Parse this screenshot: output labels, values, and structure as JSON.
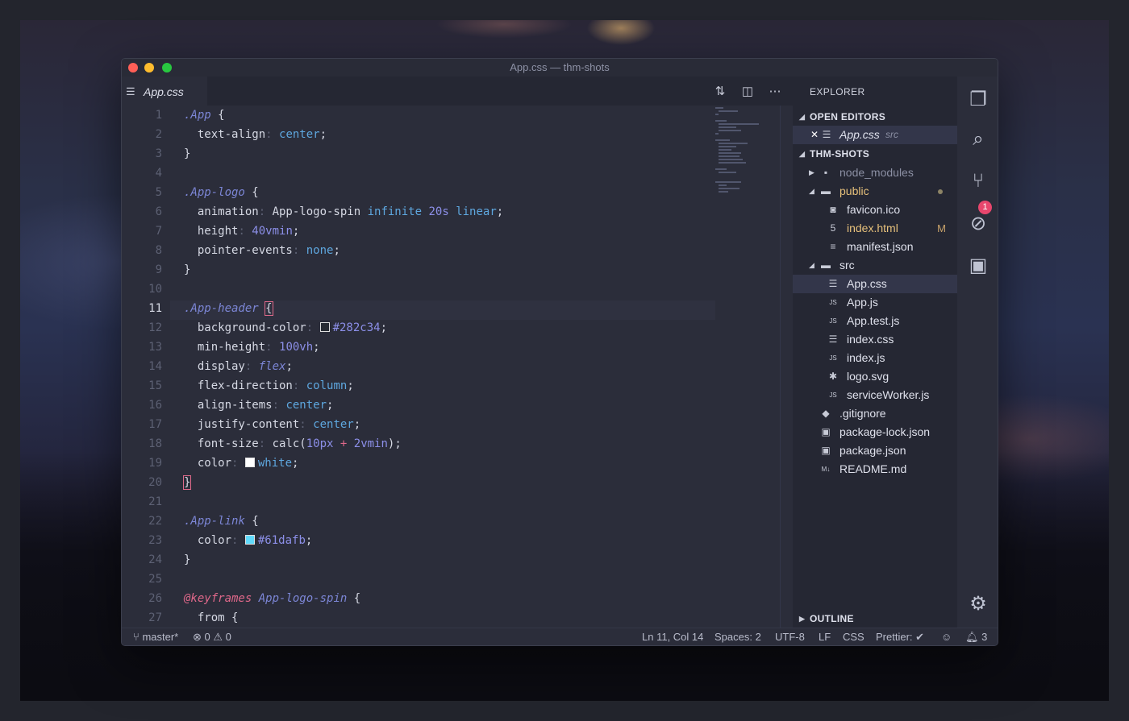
{
  "window": {
    "title": "App.css — thm-shots"
  },
  "tab": {
    "label": "App.css",
    "icon": "css-file-icon"
  },
  "tab_actions": [
    "open-changes-icon",
    "split-editor-icon",
    "more-actions-icon"
  ],
  "editor": {
    "current_line": 11,
    "line_numbers": [
      "1",
      "2",
      "3",
      "4",
      "5",
      "6",
      "7",
      "8",
      "9",
      "10",
      "11",
      "12",
      "13",
      "14",
      "15",
      "16",
      "17",
      "18",
      "19",
      "20",
      "21",
      "22",
      "23",
      "24",
      "25",
      "26",
      "27"
    ]
  },
  "code": {
    "l1_sel": ".App",
    "l1_brace": " {",
    "l2_prop": "text-align",
    "l2_val": "center",
    "l3": "}",
    "l5_sel": ".App-logo",
    "l5_brace": " {",
    "l6_prop": "animation",
    "l6_name": "App-logo-spin",
    "l6_inf": "infinite",
    "l6_time": "20s",
    "l6_lin": "linear",
    "l7_prop": "height",
    "l7_val": "40vmin",
    "l8_prop": "pointer-events",
    "l8_val": "none",
    "l9": "}",
    "l11_sel": ".App-header",
    "l11_brace": "{",
    "l12_prop": "background-color",
    "l12_val": "#282c34",
    "l13_prop": "min-height",
    "l13_val": "100vh",
    "l14_prop": "display",
    "l14_val": "flex",
    "l15_prop": "flex-direction",
    "l15_val": "column",
    "l16_prop": "align-items",
    "l16_val": "center",
    "l17_prop": "justify-content",
    "l17_val": "center",
    "l18_prop": "font-size",
    "l18_fn": "calc(",
    "l18_a": "10px",
    "l18_op": "+",
    "l18_b": "2vmin",
    "l18_end": ");",
    "l19_prop": "color",
    "l19_val": "white",
    "l20": "}",
    "l22_sel": ".App-link",
    "l22_brace": " {",
    "l23_prop": "color",
    "l23_val": "#61dafb",
    "l24": "}",
    "l26_at": "@keyframes",
    "l26_name": "App-logo-spin",
    "l26_brace": " {",
    "l27": "from {"
  },
  "swatch_colors": {
    "l12": "#282c34",
    "l19": "#ffffff",
    "l23": "#61dafb"
  },
  "sidebar": {
    "header": "EXPLORER",
    "open_editors_label": "OPEN EDITORS",
    "open_editor": {
      "name": "App.css",
      "path": "src"
    },
    "project_label": "THM-SHOTS",
    "outline_label": "OUTLINE",
    "tree": [
      {
        "name": "node_modules",
        "icon": "folder-icon",
        "muted": true
      },
      {
        "name": "public",
        "icon": "folder-open-icon",
        "modified": true
      },
      {
        "name": "favicon.ico",
        "icon": "image-file-icon"
      },
      {
        "name": "index.html",
        "icon": "html-file-icon",
        "modified": true,
        "badge": "M"
      },
      {
        "name": "manifest.json",
        "icon": "json-file-icon"
      },
      {
        "name": "src",
        "icon": "folder-open-icon"
      },
      {
        "name": "App.css",
        "icon": "css-file-icon",
        "selected": true
      },
      {
        "name": "App.js",
        "icon": "js-file-icon"
      },
      {
        "name": "App.test.js",
        "icon": "js-file-icon"
      },
      {
        "name": "index.css",
        "icon": "css-file-icon"
      },
      {
        "name": "index.js",
        "icon": "js-file-icon"
      },
      {
        "name": "logo.svg",
        "icon": "svg-file-icon"
      },
      {
        "name": "serviceWorker.js",
        "icon": "js-file-icon"
      },
      {
        "name": ".gitignore",
        "icon": "git-file-icon"
      },
      {
        "name": "package-lock.json",
        "icon": "npm-file-icon"
      },
      {
        "name": "package.json",
        "icon": "npm-file-icon"
      },
      {
        "name": "README.md",
        "icon": "markdown-file-icon"
      }
    ]
  },
  "activity": {
    "scm_badge": "1"
  },
  "status": {
    "branch": "master*",
    "errors": "0",
    "warnings": "0",
    "position": "Ln 11, Col 14",
    "spaces": "Spaces: 2",
    "encoding": "UTF-8",
    "eol": "LF",
    "language": "CSS",
    "prettier": "Prettier: ✔",
    "notifications": "3"
  }
}
